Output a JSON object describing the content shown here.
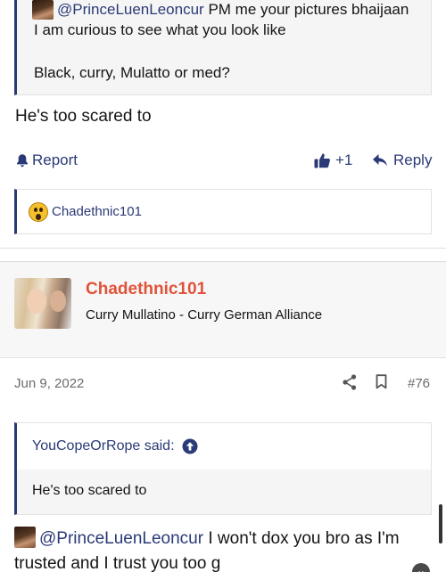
{
  "previous_post": {
    "quote": {
      "mention": "@PrinceLuenLeoncur",
      "line1_rest": "PM me your pictures bhaijaan",
      "line2": "I am curious to see what you look like",
      "line3": "Black, curry, Mulatto or med?"
    },
    "body": "He's too scared to",
    "actions": {
      "report_label": "Report",
      "like_count": "+1",
      "reply_label": "Reply"
    },
    "reactions": {
      "user": "Chadethnic101",
      "emoji_icon": "astonished-face-icon"
    }
  },
  "post": {
    "user": {
      "name": "Chadethnic101",
      "title": "Curry Mullatino - Curry German Alliance",
      "name_color": "#e0533a"
    },
    "meta": {
      "date": "Jun 9, 2022",
      "number": "#76"
    },
    "quote": {
      "attribution": "YouCopeOrRope said:",
      "text": "He's too scared to"
    },
    "body": {
      "mention": "@PrinceLuenLeoncur",
      "text": " I won't dox you bro as I'm trusted and I trust you too g"
    }
  },
  "colors": {
    "accent": "#2a3a76",
    "muted": "#6b6b6b",
    "quote_bg": "#f5f5f5"
  }
}
